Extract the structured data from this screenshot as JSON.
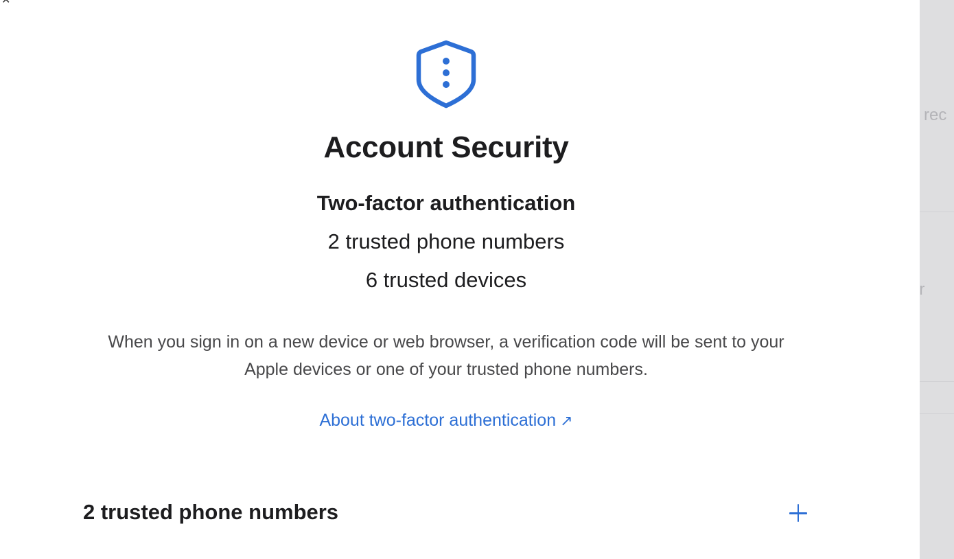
{
  "background_window": {
    "partial_text_top": "o rec",
    "partial_text_middle": "er"
  },
  "dialog": {
    "icon": "shield-ellipsis-icon",
    "title": "Account Security",
    "subtitle": "Two-factor authentication",
    "trusted_phone_numbers_summary": "2 trusted phone numbers",
    "trusted_devices_summary": "6 trusted devices",
    "description": "When you sign in on a new device or web browser, a verification code will be sent to your Apple devices or one of your trusted phone numbers.",
    "about_link_label": "About two-factor authentication",
    "about_link_arrow": "↗",
    "phone_section_heading": "2 trusted phone numbers",
    "add_icon": "plus-icon"
  },
  "colors": {
    "accent": "#2d6fd5",
    "text_primary": "#1d1d1f",
    "text_secondary": "#48484a",
    "backdrop": "#dedee0"
  }
}
